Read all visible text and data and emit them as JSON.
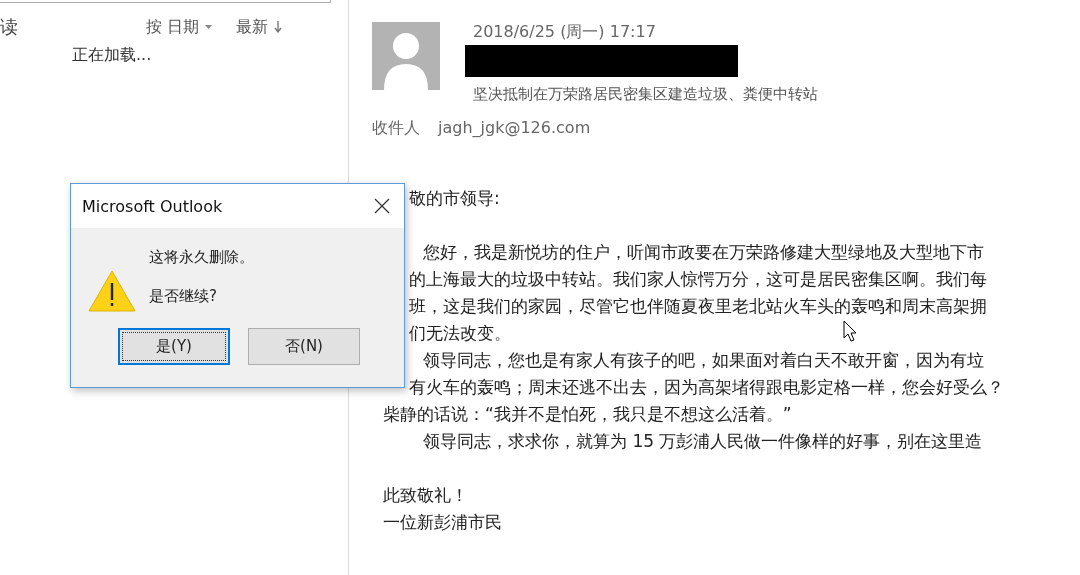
{
  "message_list": {
    "filter": "读",
    "sort_by": "按 日期",
    "sort_order": "最新",
    "loading": "正在加载..."
  },
  "message": {
    "date": "2018/6/25 (周一) 17:17",
    "subject": "坚决抵制在万荣路居民密集区建造垃圾、粪便中转站",
    "to_label": "收件人",
    "to": "jagh_jgk@126.com",
    "body": [
      {
        "kind": "cut",
        "text": "敬的市领导:"
      },
      {
        "kind": "blank"
      },
      {
        "kind": "indent",
        "text": "您好，我是新悦坊的住户，听闻市政要在万荣路修建大型绿地及大型地下市"
      },
      {
        "kind": "cut",
        "text": "的上海最大的垃圾中转站。我们家人惊愕万分，这可是居民密集区啊。我们每"
      },
      {
        "kind": "cut",
        "text": "班，这是我们的家园，尽管它也伴随夏夜里老北站火车头的轰鸣和周末高架拥"
      },
      {
        "kind": "cut",
        "text": "们无法改变。"
      },
      {
        "kind": "indent",
        "text": "领导同志，您也是有家人有孩子的吧，如果面对着白天不敢开窗，因为有垃"
      },
      {
        "kind": "cut",
        "text": "有火车的轰鸣；周末还逃不出去，因为高架堵得跟电影定格一样，您会好受么？"
      },
      {
        "kind": "plain",
        "text": "柴静的话说：“我并不是怕死，我只是不想这么活着。”"
      },
      {
        "kind": "indent",
        "text": "领导同志，求求你，就算为 15 万彭浦人民做一件像样的好事，别在这里造"
      },
      {
        "kind": "blank"
      },
      {
        "kind": "plain",
        "text": "此致敬礼！"
      },
      {
        "kind": "plain",
        "text": "一位新彭浦市民"
      }
    ]
  },
  "dialog": {
    "title": "Microsoft Outlook",
    "message": "这将永久删除。",
    "question": "是否继续?",
    "buttons": [
      {
        "label": "是(Y)",
        "selected": true
      },
      {
        "label": "否(N)",
        "selected": false
      }
    ]
  }
}
